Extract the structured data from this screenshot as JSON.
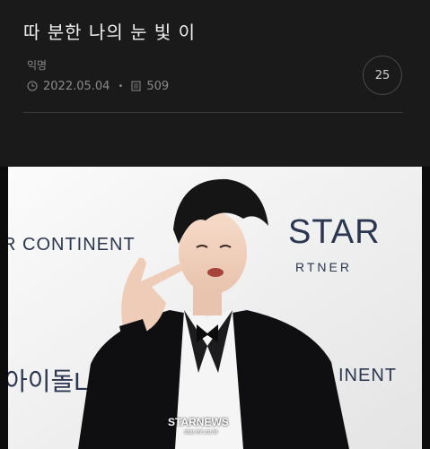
{
  "post": {
    "title": "따 분한 나의 눈 빛 이",
    "author": "익명",
    "date": "2022.05.04",
    "views": "509",
    "comment_count": "25"
  },
  "photo": {
    "backdrop_texts": {
      "continent_left": "R CONTINENT",
      "star": "STAR",
      "partner": "RTNER",
      "idol": "아이돌L",
      "continent_right": "INENT"
    },
    "watermark": "STARNEWS",
    "watermark_url": "star.mt.co.kr"
  },
  "icons": {
    "clock": "clock-icon",
    "views": "document-icon"
  },
  "colors": {
    "background": "#0c0c0c",
    "header_background": "#1a1a1a",
    "title_text": "#f1f1f1",
    "meta_text": "#8a8a8a",
    "divider": "#3a3a3a",
    "backdrop_text": "#2b3650"
  }
}
